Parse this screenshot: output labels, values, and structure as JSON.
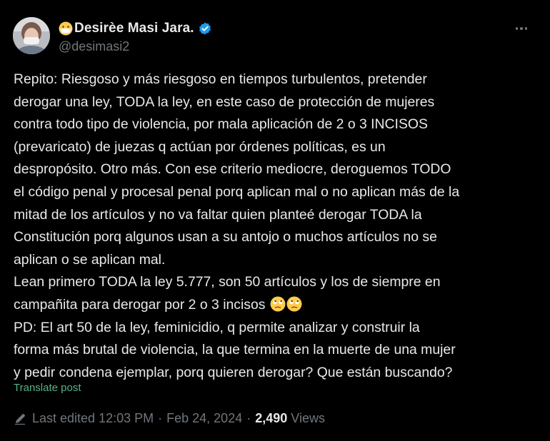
{
  "author": {
    "display_name": "Desirèe Masi Jara.",
    "handle": "@desimasi2",
    "name_emoji": "face-with-medical-mask-emoji",
    "verified": true,
    "verified_color": "#1d9bf0"
  },
  "more_icon": "more-horizontal-icon",
  "tweet": {
    "lines": [
      "Repito: Riesgoso y más riesgoso en tiempos turbulentos, pretender",
      "derogar una ley, TODA la ley, en este caso de protección de mujeres",
      "contra todo tipo de violencia, por mala aplicación  de 2 o 3  INCISOS",
      "(prevaricato) de juezas q actúan por órdenes políticas, es un",
      "despropósito. Otro más. Con ese criterio mediocre, deroguemos TODO",
      "el código penal y procesal penal porq aplican mal o no aplican más de la",
      "mitad de los artículos y no va faltar quien planteé derogar TODA la",
      "Constitución porq algunos usan a su antojo o muchos artículos no se",
      "aplican o se aplican mal.",
      "Lean primero TODA la ley 5.777,  son 50 artículos y los de siempre en",
      "campañita para derogar  por 2 o 3 incisos ",
      "PD:  El art  50 de la ley, feminicidio, q permite analizar y construir la",
      "forma más brutal de violencia, la que termina en  la muerte de una mujer",
      "y pedir condena ejemplar,  porq quieren derogar? Que están buscando?"
    ],
    "inline_emojis": [
      "face-with-rolling-eyes-emoji",
      "face-with-rolling-eyes-emoji"
    ]
  },
  "translate_label": "Translate post",
  "meta": {
    "edit_icon": "pencil-icon",
    "edited_label": "Last edited 12:03 PM",
    "separator": "·",
    "date": "Feb 24, 2024",
    "views_count": "2,490",
    "views_label": "Views"
  },
  "colors": {
    "background": "#000000",
    "text": "#e7e9ea",
    "secondary": "#71767b",
    "translate": "#58b38a"
  }
}
